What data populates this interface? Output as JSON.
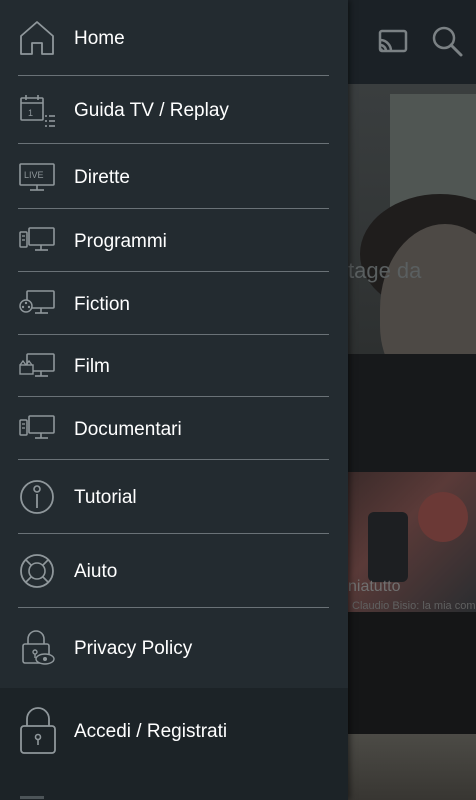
{
  "drawer": {
    "items": [
      {
        "label": "Home",
        "icon": "home-icon"
      },
      {
        "label": "Guida TV / Replay",
        "icon": "calendar-list-icon"
      },
      {
        "label": "Dirette",
        "icon": "live-tv-icon"
      },
      {
        "label": "Programmi",
        "icon": "tv-programs-icon"
      },
      {
        "label": "Fiction",
        "icon": "tv-fiction-icon"
      },
      {
        "label": "Film",
        "icon": "tv-film-icon"
      },
      {
        "label": "Documentari",
        "icon": "tv-documentary-icon"
      },
      {
        "label": "Tutorial",
        "icon": "info-circle-icon"
      },
      {
        "label": "Aiuto",
        "icon": "lifebuoy-icon"
      },
      {
        "label": "Privacy Policy",
        "icon": "lock-eye-icon"
      }
    ],
    "login": {
      "label": "Accedi / Registrati",
      "icon": "lock-icon"
    },
    "live_badge": "LIVE",
    "calendar_day": "1"
  },
  "background": {
    "top_icons": [
      "cast-icon",
      "search-icon"
    ],
    "hero_caption": "tage da",
    "card_title": "niatutto",
    "card_subtitle": "Claudio Bisio: la mia comi"
  },
  "colors": {
    "drawer_bg": "#232b30",
    "login_bg": "#1c2327",
    "divider": "#6a7277",
    "icon_stroke": "#8f979b",
    "text": "#ffffff"
  }
}
